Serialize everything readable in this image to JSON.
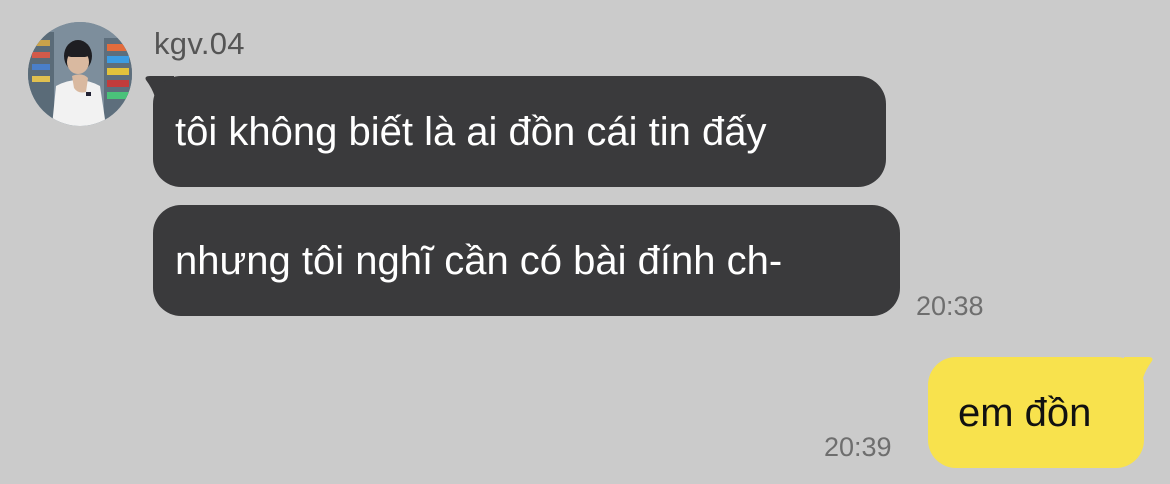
{
  "conversation": {
    "sender": {
      "name": "kgv.04",
      "avatar": "profile-photo"
    },
    "messages": [
      {
        "direction": "incoming",
        "text": "tôi không biết là ai đồn cái tin đấy"
      },
      {
        "direction": "incoming",
        "text": "nhưng tôi nghĩ cần có bài đính ch-",
        "time": "20:38"
      },
      {
        "direction": "outgoing",
        "text": "em đồn",
        "time": "20:39"
      }
    ]
  },
  "colors": {
    "background": "#cbcbcb",
    "incoming_bubble": "#3a3a3c",
    "outgoing_bubble": "#f8e24d"
  }
}
